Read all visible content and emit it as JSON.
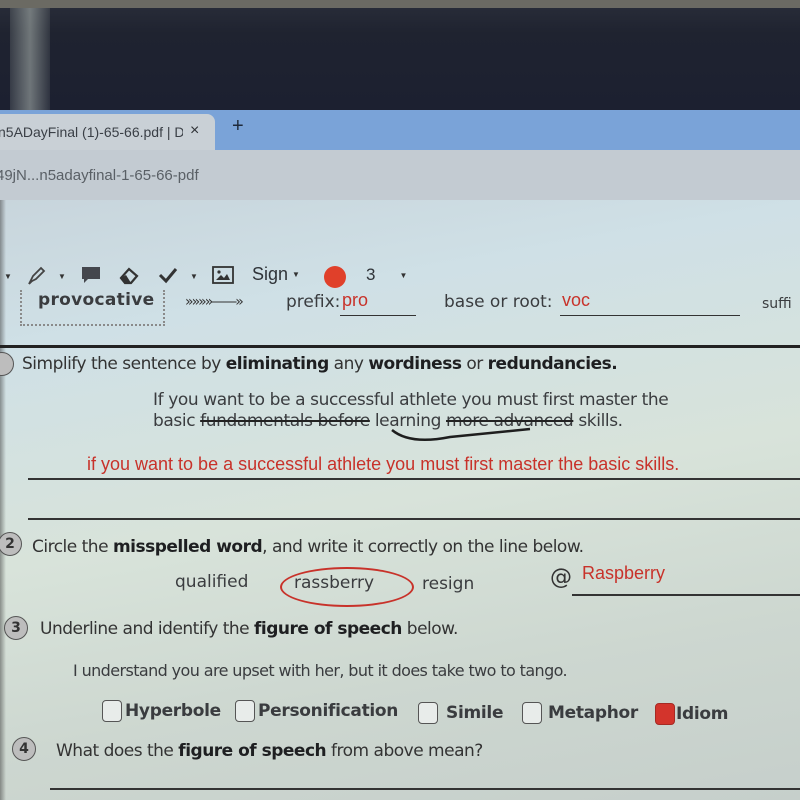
{
  "browser": {
    "tab_title": "n5ADayFinal (1)-65-66.pdf | D",
    "tab_close": "×",
    "new_tab": "+",
    "url": "49jN...n5adayfinal-1-65-66-pdf"
  },
  "toolbar": {
    "sign_label": "Sign",
    "pen_size": "3",
    "ink_color": "#e0402a"
  },
  "vocab_row": {
    "word": "provocative",
    "arrow": "»»»»——»",
    "prefix_label": "prefix:",
    "prefix_value": "pro",
    "root_label": "base or root:",
    "root_value": "voc",
    "suffix_label": "suffi"
  },
  "q1": {
    "prompt_parts": [
      "Simplify the sentence by ",
      "eliminating",
      " any ",
      "wordiness",
      " or ",
      "redundancies."
    ],
    "line1": "If you want to be a successful athlete you must first master the",
    "line2_a": "basic ",
    "line2_strike1": "fundamentals before",
    "line2_b": " learning ",
    "line2_strike2": "more advanced",
    "line2_c": " skills.",
    "answer": "if you want to be a successful athlete you must first master the basic skills."
  },
  "q2": {
    "number": "2",
    "prompt_a": "Circle the ",
    "prompt_bold": "misspelled word",
    "prompt_b": ", and write it correctly on the line below.",
    "choices": [
      "qualified",
      "rassberry",
      "resign"
    ],
    "circled": "rassberry",
    "answer": "Raspberry"
  },
  "q3": {
    "number": "3",
    "prompt_a": "Underline and identify the ",
    "prompt_bold": "figure of speech",
    "prompt_b": " below.",
    "sentence": "I understand you are upset with her, but it does take two to tango.",
    "options": [
      {
        "label": "Hyperbole",
        "checked": false
      },
      {
        "label": "Personification",
        "checked": false
      },
      {
        "label": "Simile",
        "checked": false
      },
      {
        "label": "Metaphor",
        "checked": false
      },
      {
        "label": "Idiom",
        "checked": true
      }
    ]
  },
  "q4": {
    "number": "4",
    "prompt_a": "What does the ",
    "prompt_bold": "figure of speech",
    "prompt_b": " from above mean?"
  },
  "colors": {
    "annotation_red": "#c8322a",
    "tab_strip_blue": "#7aa3d8"
  }
}
